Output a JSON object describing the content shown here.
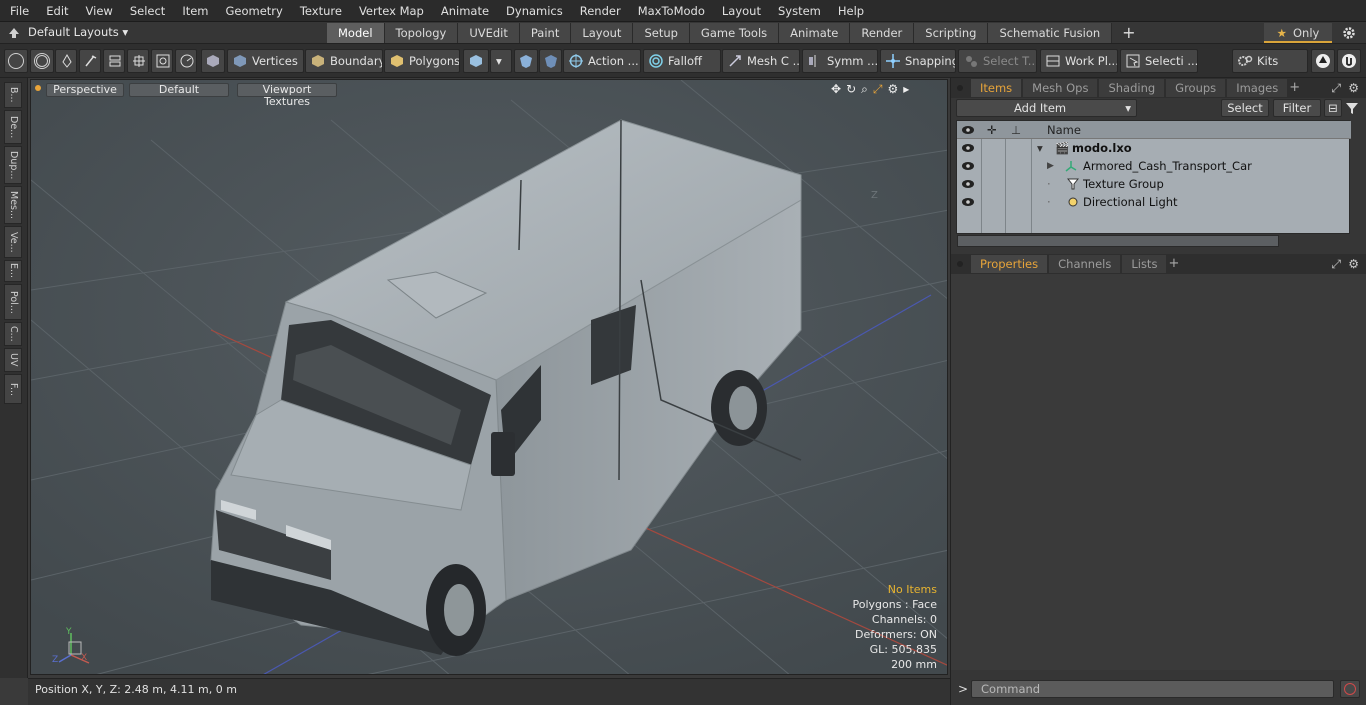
{
  "menu": [
    "File",
    "Edit",
    "View",
    "Select",
    "Item",
    "Geometry",
    "Texture",
    "Vertex Map",
    "Animate",
    "Dynamics",
    "Render",
    "MaxToModo",
    "Layout",
    "System",
    "Help"
  ],
  "layout_bar": {
    "layouts_label": "Default Layouts",
    "tabs": [
      "Model",
      "Topology",
      "UVEdit",
      "Paint",
      "Layout",
      "Setup",
      "Game Tools",
      "Animate",
      "Render",
      "Scripting",
      "Schematic Fusion"
    ],
    "active_tab": "Model",
    "only_label": "Only"
  },
  "toolbar": {
    "vertices": "Vertices",
    "boundary": "Boundary",
    "polygons": "Polygons",
    "action": "Action ...",
    "falloff": "Falloff",
    "mesh_c": "Mesh C ...",
    "symm": "Symm ...",
    "snapping": "Snapping",
    "select_t": "Select T...",
    "work_pl": "Work Pl...",
    "selecti": "Selecti ...",
    "kits": "Kits"
  },
  "left_tabs": [
    "B...",
    "De...",
    "Dup...",
    "Mes...",
    "Ve...",
    "E...",
    "Pol...",
    "C...",
    "UV",
    "F..."
  ],
  "viewport": {
    "perspective": "Perspective",
    "default": "Default",
    "viewport_textures": "Viewport Textures",
    "axis_z_label": "Z",
    "stats": {
      "no_items": "No Items",
      "polygons": "Polygons : Face",
      "channels": "Channels: 0",
      "deformers": "Deformers: ON",
      "gl": "GL: 505,835",
      "scale": "200 mm"
    },
    "colors": {
      "no_items": "#e8b430",
      "grid_x": "#b04a40",
      "grid_z": "#4a5ab8",
      "body": "#a3aaaf"
    }
  },
  "status": {
    "position": "Position X, Y, Z:   2.48 m, 4.11 m, 0 m"
  },
  "items_panel": {
    "tabs": [
      "Items",
      "Mesh Ops",
      "Shading",
      "Groups",
      "Images"
    ],
    "active_tab": "Items",
    "add_item": "Add Item",
    "select": "Select",
    "filter": "Filter",
    "name_header": "Name",
    "rows": [
      {
        "label": "modo.lxo",
        "icon": "scene-icon"
      },
      {
        "label": "Armored_Cash_Transport_Car",
        "icon": "mesh-icon"
      },
      {
        "label": "Texture Group",
        "icon": "texture-group-icon"
      },
      {
        "label": "Directional Light",
        "icon": "light-icon"
      }
    ]
  },
  "properties_panel": {
    "tabs": [
      "Properties",
      "Channels",
      "Lists"
    ],
    "active_tab": "Properties"
  },
  "command": {
    "placeholder": "Command",
    "prompt": ">"
  }
}
